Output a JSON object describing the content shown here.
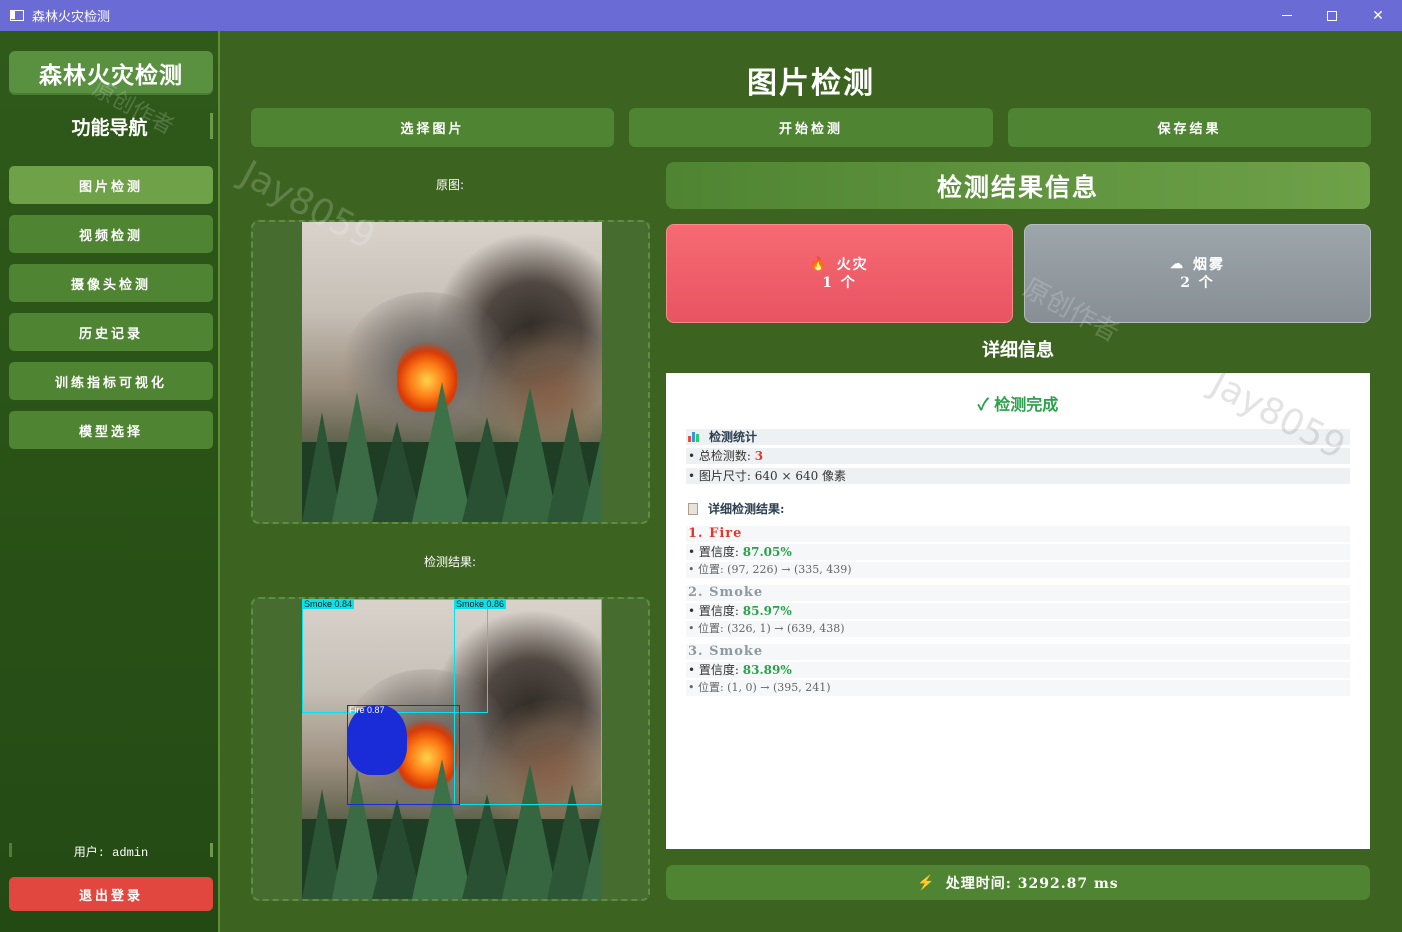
{
  "window": {
    "title": "森林火灾检测"
  },
  "sidebar": {
    "brand": "森林火灾检测",
    "nav_header": "功能导航",
    "items": [
      {
        "label": "图片检测",
        "active": true
      },
      {
        "label": "视频检测",
        "active": false
      },
      {
        "label": "摄像头检测",
        "active": false
      },
      {
        "label": "历史记录",
        "active": false
      },
      {
        "label": "训练指标可视化",
        "active": false
      },
      {
        "label": "模型选择",
        "active": false
      }
    ],
    "user": "用户: admin",
    "logout": "退出登录"
  },
  "main": {
    "title": "图片检测",
    "buttons": {
      "select": "选择图片",
      "detect": "开始检测",
      "save": "保存结果"
    },
    "original_label": "原图:",
    "result_label": "检测结果:",
    "boxes": [
      {
        "label": "Smoke 0.84",
        "color": "#00e5ee"
      },
      {
        "label": "Smoke 0.86",
        "color": "#00e5ee"
      },
      {
        "label": "Fire 0.87",
        "color": "#1a2bd8"
      }
    ]
  },
  "results": {
    "title": "检测结果信息",
    "fire_card": {
      "icon": "fire-emoji",
      "name": "火灾",
      "count": "1 个",
      "color": "#f0616c"
    },
    "smoke_card": {
      "icon": "cloud-emoji",
      "name": "烟雾",
      "count": "2 个",
      "color": "#939ba0"
    },
    "detail_header": "详细信息",
    "detail": {
      "done": "✓ 检测完成",
      "stats_title": "检测统计",
      "total_label": "• 总检测数: ",
      "total_value": "3",
      "size": "• 图片尺寸: 640 × 640 像素",
      "results_title": "详细检测结果:",
      "items": [
        {
          "title": "1. Fire",
          "conf_label": "• 置信度: ",
          "conf": "87.05%",
          "pos": "• 位置: (97, 226) → (335, 439)"
        },
        {
          "title": "2. Smoke",
          "conf_label": "• 置信度: ",
          "conf": "85.97%",
          "pos": "• 位置: (326, 1) → (639, 438)"
        },
        {
          "title": "3. Smoke",
          "conf_label": "• 置信度: ",
          "conf": "83.89%",
          "pos": "• 位置: (1, 0) → (395, 241)"
        }
      ]
    },
    "time_label": "处理时间: 3292.87 ms"
  },
  "watermark": "Jay8059",
  "watermark_cn": "原创作者"
}
